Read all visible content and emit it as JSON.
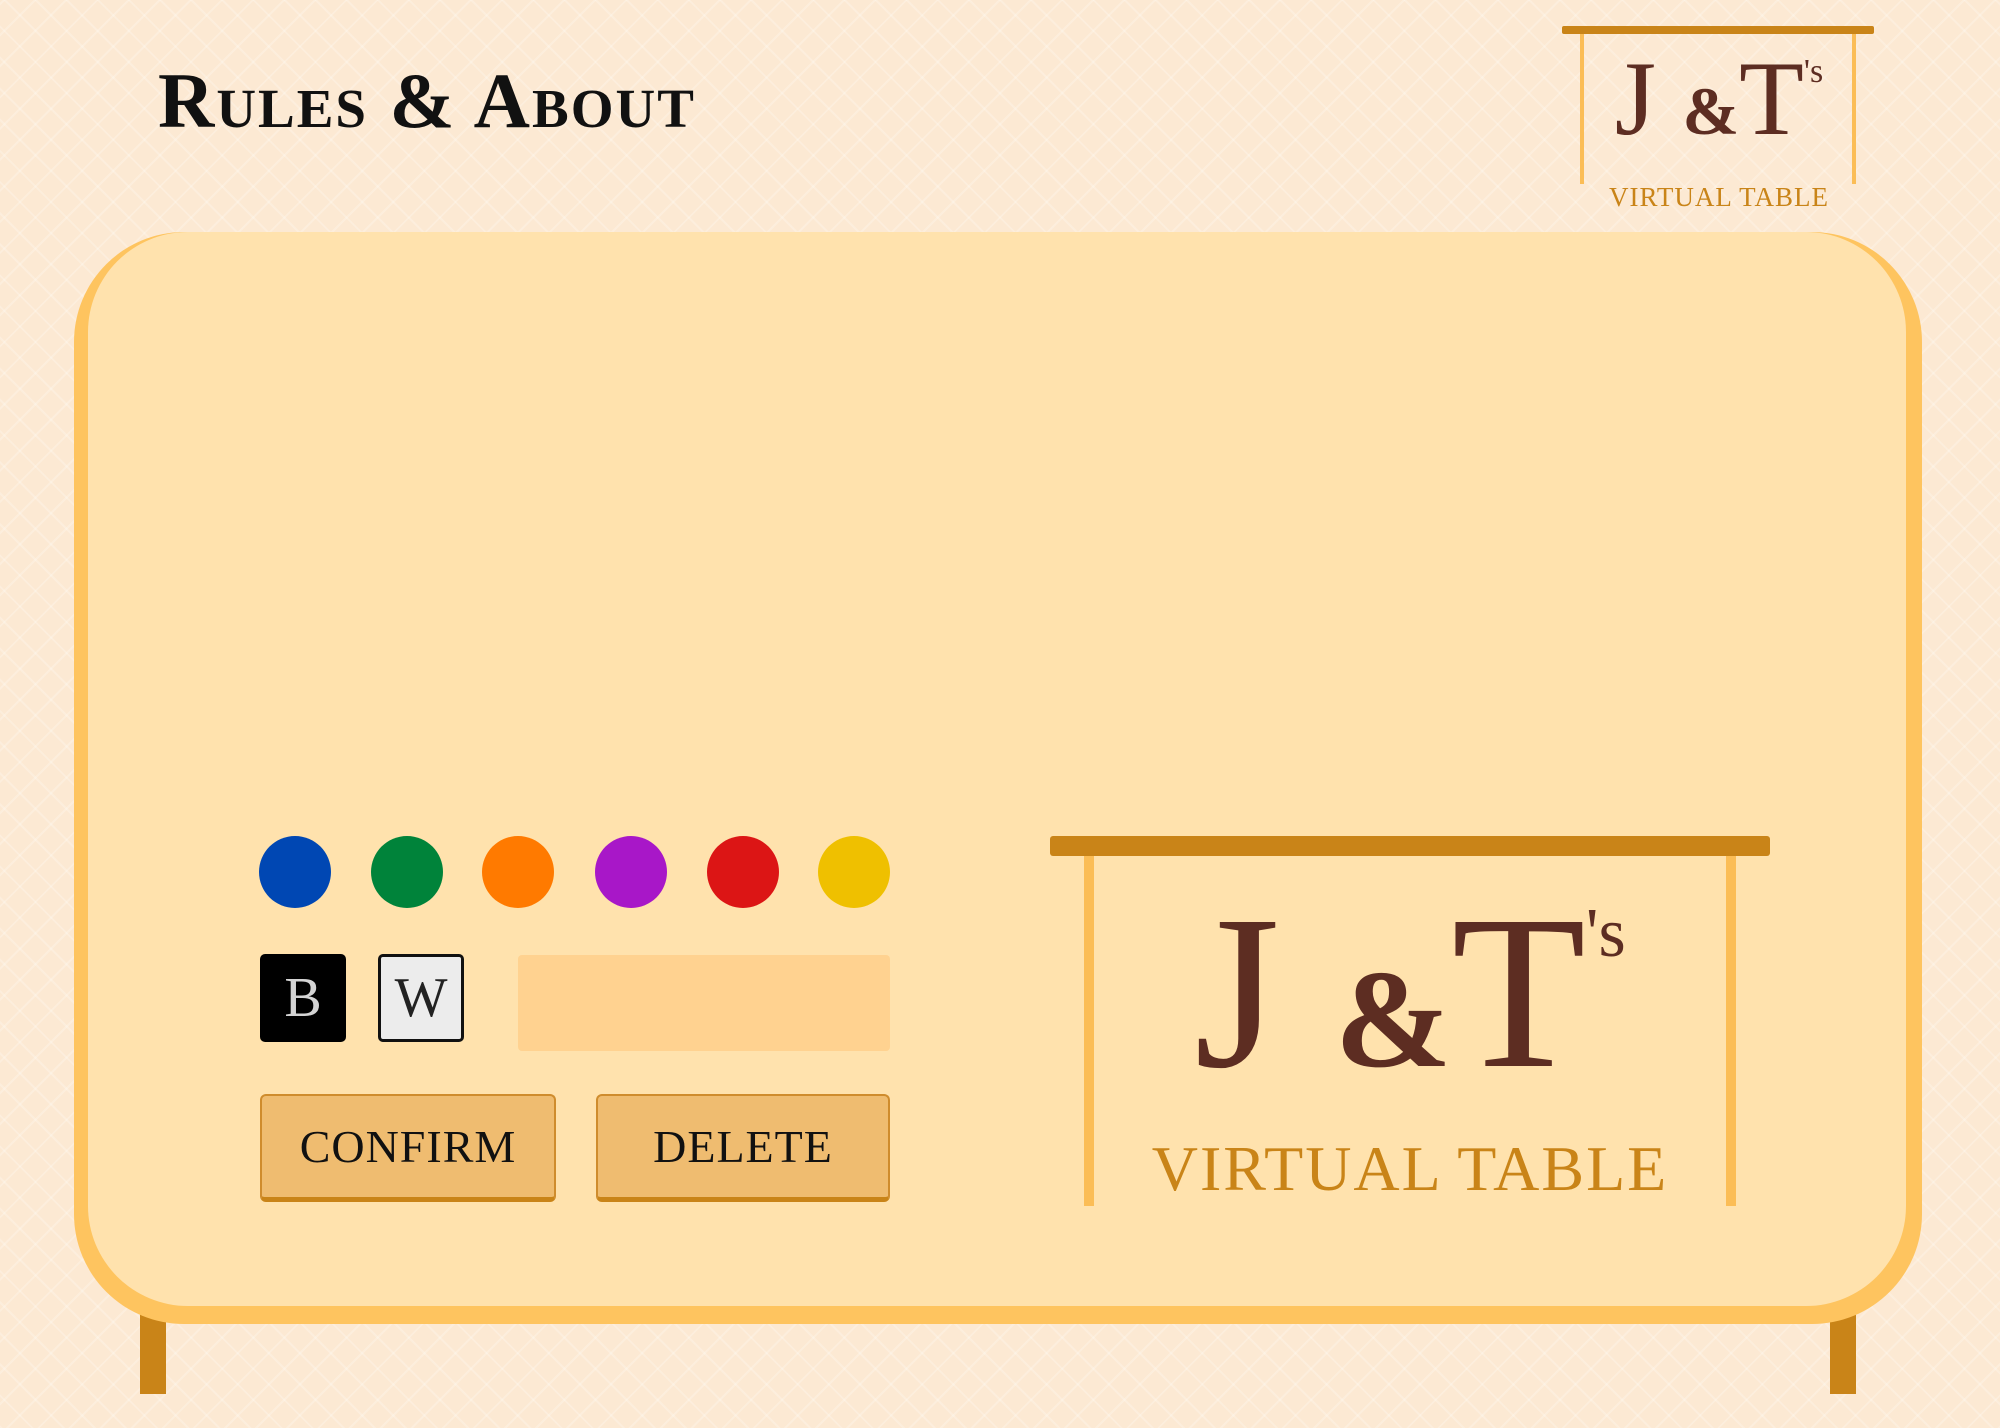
{
  "page": {
    "title": "Rules & About"
  },
  "logo": {
    "monogram_j": "J",
    "monogram_amp": "&",
    "monogram_t": "T",
    "monogram_suffix": "'s",
    "subtitle": "VIRTUAL TABLE"
  },
  "colors": {
    "background": "#fce9d3",
    "board_edge": "#fec45f",
    "board_surface": "#ffe2ad",
    "wood": "#c98418",
    "logo_text": "#5d2d22",
    "palette": [
      "#0047b3",
      "#00833a",
      "#ff7a00",
      "#a817c8",
      "#dc1515",
      "#efc000"
    ]
  },
  "tiles": {
    "black_label": "B",
    "white_label": "W"
  },
  "text_box": {
    "value": "",
    "placeholder": ""
  },
  "buttons": {
    "confirm": "CONFIRM",
    "delete": "DELETE"
  }
}
